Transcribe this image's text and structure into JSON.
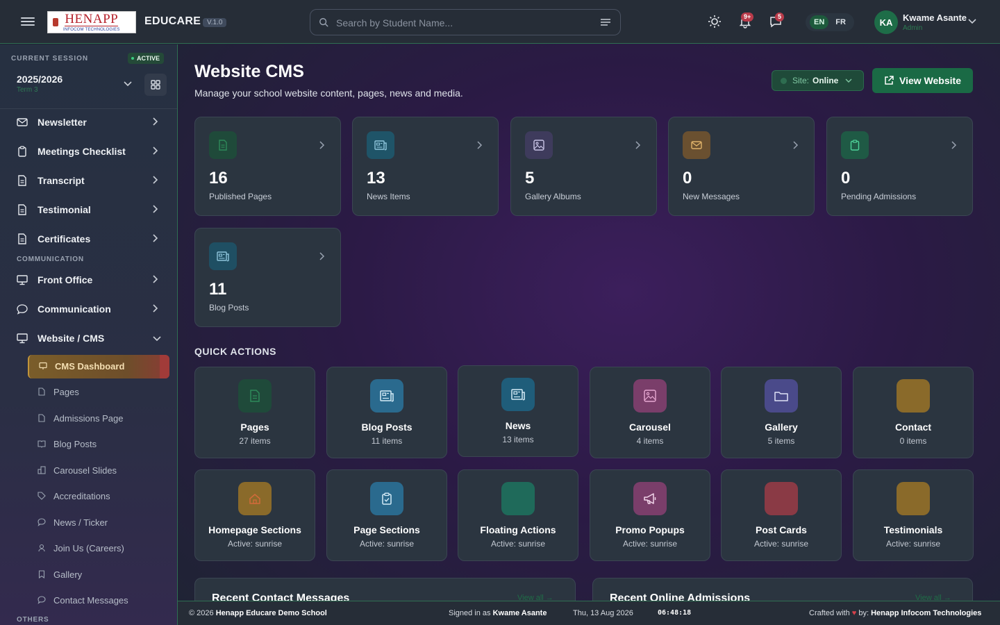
{
  "header": {
    "app_name": "EDUCARE",
    "version": "V.1.0",
    "logo_text": "HENAPP",
    "logo_subtext": "INFOCOM TECHNOLOGIES",
    "search_placeholder": "Search by Student Name...",
    "notif_badge": "9+",
    "msg_badge": "5",
    "lang_en": "EN",
    "lang_fr": "FR",
    "user_initials": "KA",
    "user_name": "Kwame Asante",
    "user_role": "Admin",
    "accent": "#1a6a45"
  },
  "sidebar": {
    "session_label": "CURRENT SESSION",
    "active_badge": "ACTIVE",
    "session_year": "2025/2026",
    "session_term": "Term 3",
    "items": [
      {
        "label": "Newsletter",
        "icon": "mail-icon"
      },
      {
        "label": "Meetings Checklist",
        "icon": "clipboard-icon"
      },
      {
        "label": "Transcript",
        "icon": "document-icon"
      },
      {
        "label": "Testimonial",
        "icon": "document-icon"
      },
      {
        "label": "Certificates",
        "icon": "document-icon"
      }
    ],
    "section_communication": "COMMUNICATION",
    "comm_items": [
      {
        "label": "Front Office",
        "icon": "monitor-icon"
      },
      {
        "label": "Communication",
        "icon": "chat-icon"
      },
      {
        "label": "Website / CMS",
        "icon": "monitor-icon"
      }
    ],
    "cms_sub": [
      {
        "label": "CMS Dashboard",
        "icon": "monitor-icon",
        "active": true
      },
      {
        "label": "Pages",
        "icon": "file-icon"
      },
      {
        "label": "Admissions Page",
        "icon": "file-icon"
      },
      {
        "label": "Blog Posts",
        "icon": "book-icon"
      },
      {
        "label": "Carousel Slides",
        "icon": "slides-icon"
      },
      {
        "label": "Accreditations",
        "icon": "tag-icon"
      },
      {
        "label": "News / Ticker",
        "icon": "chat-icon"
      },
      {
        "label": "Join Us (Careers)",
        "icon": "user-icon"
      },
      {
        "label": "Gallery",
        "icon": "bookmark-icon"
      },
      {
        "label": "Contact Messages",
        "icon": "chat-icon"
      }
    ],
    "section_others": "OTHERS"
  },
  "main": {
    "title": "Website CMS",
    "subtitle": "Manage your school website content, pages, news and media.",
    "site_label": "Site:",
    "site_status": "Online",
    "view_website": "View Website",
    "stats": [
      {
        "value": "16",
        "label": "Published Pages",
        "color": "#1f4a3a",
        "icon": "file-icon"
      },
      {
        "value": "13",
        "label": "News Items",
        "color": "#1f5468",
        "icon": "news-icon"
      },
      {
        "value": "5",
        "label": "Gallery Albums",
        "color": "#3e3b5c",
        "icon": "image-icon"
      },
      {
        "value": "0",
        "label": "New Messages",
        "color": "#6a5030",
        "icon": "mail-icon"
      },
      {
        "value": "0",
        "label": "Pending Admissions",
        "color": "#1f5a45",
        "icon": "clipboard-icon"
      },
      {
        "value": "11",
        "label": "Blog Posts",
        "color": "#1f4f63",
        "icon": "news-icon"
      }
    ],
    "quick_actions_title": "QUICK ACTIONS",
    "quick_actions": [
      {
        "name": "Pages",
        "sub": "27 items",
        "color": "#1f4a3a",
        "icon": "file-icon"
      },
      {
        "name": "Blog Posts",
        "sub": "11 items",
        "color": "#2a6a8e",
        "icon": "news-icon"
      },
      {
        "name": "News",
        "sub": "13 items",
        "color": "#1f5d7a",
        "icon": "news-icon"
      },
      {
        "name": "Carousel",
        "sub": "4 items",
        "color": "#7a3e6a",
        "icon": "image-icon"
      },
      {
        "name": "Gallery",
        "sub": "5 items",
        "color": "#4a4a8a",
        "icon": "folder-icon"
      },
      {
        "name": "Contact",
        "sub": "0 items",
        "color": "#8a6a2a",
        "icon": "mail-icon"
      },
      {
        "name": "Homepage Sections",
        "sub": "Active: sunrise",
        "color": "#8a6a2a",
        "icon": "home-icon"
      },
      {
        "name": "Page Sections",
        "sub": "Active: sunrise",
        "color": "#2a6a8e",
        "icon": "clipboard-icon"
      },
      {
        "name": "Floating Actions",
        "sub": "Active: sunrise",
        "color": "#1f6a5a",
        "icon": "blank-icon"
      },
      {
        "name": "Promo Popups",
        "sub": "Active: sunrise",
        "color": "#7a3e6a",
        "icon": "megaphone-icon"
      },
      {
        "name": "Post Cards",
        "sub": "Active: sunrise",
        "color": "#8a3a45",
        "icon": "blank-icon"
      },
      {
        "name": "Testimonials",
        "sub": "Active: sunrise",
        "color": "#8a6a2a",
        "icon": "blank-icon"
      }
    ],
    "recent_contact": "Recent Contact Messages",
    "recent_admissions": "Recent Online Admissions",
    "view_all": "View all →"
  },
  "footer": {
    "copyright": "© 2026",
    "school": "Henapp Educare Demo School",
    "signed_prefix": "Signed in as",
    "signed_user": "Kwame Asante",
    "date": "Thu, 13 Aug 2026",
    "time": "06:48:18",
    "crafted_prefix": "Crafted with",
    "crafted_by": "by:",
    "company": "Henapp Infocom Technologies"
  }
}
